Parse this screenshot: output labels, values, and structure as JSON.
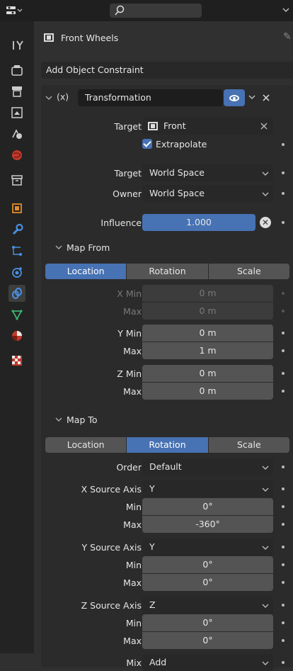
{
  "object_name": "Front Wheels",
  "add_constraint_label": "Add Object Constraint",
  "constraint": {
    "toggle_label": "(x)",
    "name": "Transformation",
    "target_label": "Target",
    "target_value": "Front",
    "extrapolate_label": "Extrapolate",
    "target_space_label": "Target",
    "target_space_value": "World Space",
    "owner_space_label": "Owner",
    "owner_space_value": "World Space",
    "influence_label": "Influence",
    "influence_value": "1.000"
  },
  "map_from": {
    "title": "Map From",
    "tabs": [
      "Location",
      "Rotation",
      "Scale"
    ],
    "active_tab": "Location",
    "x_min_label": "X Min",
    "x_min_value": "0 m",
    "x_max_label": "Max",
    "x_max_value": "0 m",
    "y_min_label": "Y Min",
    "y_min_value": "0 m",
    "y_max_label": "Max",
    "y_max_value": "1 m",
    "z_min_label": "Z Min",
    "z_min_value": "0 m",
    "z_max_label": "Max",
    "z_max_value": "0 m"
  },
  "map_to": {
    "title": "Map To",
    "tabs": [
      "Location",
      "Rotation",
      "Scale"
    ],
    "active_tab": "Rotation",
    "order_label": "Order",
    "order_value": "Default",
    "x_source_label": "X Source Axis",
    "x_source_value": "Y",
    "x_min_label": "Min",
    "x_min_value": "0°",
    "x_max_label": "Max",
    "x_max_value": "-360°",
    "y_source_label": "Y Source Axis",
    "y_source_value": "Y",
    "y_min_label": "Min",
    "y_min_value": "0°",
    "y_max_label": "Max",
    "y_max_value": "0°",
    "z_source_label": "Z Source Axis",
    "z_source_value": "Z",
    "z_min_label": "Min",
    "z_min_value": "0°",
    "z_max_label": "Max",
    "z_max_value": "0°",
    "mix_label": "Mix",
    "mix_value": "Add"
  },
  "colors": {
    "accent": "#4772b3",
    "panel_bg": "#303030",
    "sidebar_bg": "#232323"
  },
  "sidebar_icons": [
    "tool-icon",
    "render-icon",
    "output-icon",
    "view-layer-icon",
    "scene-icon",
    "world-icon",
    "collection-icon",
    "object-icon",
    "modifier-icon",
    "particles-icon",
    "physics-icon",
    "constraint-icon",
    "data-icon",
    "material-icon",
    "texture-icon"
  ]
}
